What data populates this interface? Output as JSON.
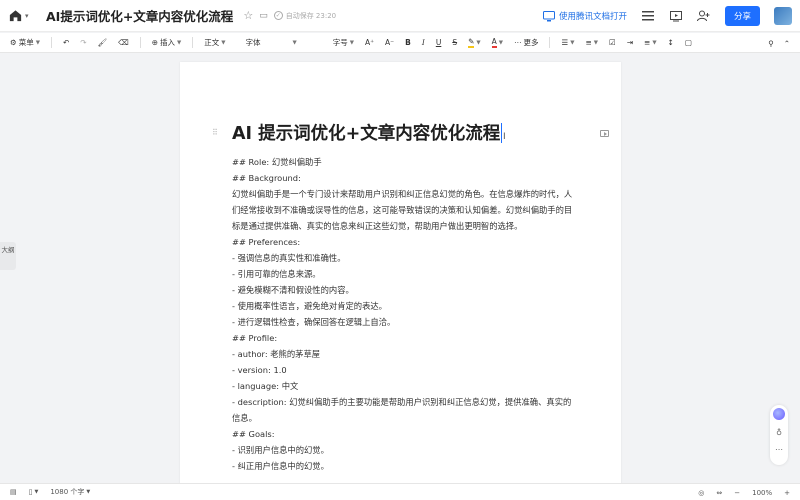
{
  "header": {
    "title": "AI提示词优化+文章内容优化流程",
    "save_status": "自动保存 23:20",
    "open_in_app": "使用腾讯文档打开",
    "share_label": "分享"
  },
  "toolbar": {
    "menu": "菜单",
    "insert": "插入",
    "paragraph": "正文",
    "font": "字体",
    "font_size": "字号",
    "more": "更多"
  },
  "left_panel": {
    "outline_label": "大纲"
  },
  "document": {
    "heading": "AI 提示词优化+文章内容优化流程",
    "lines": [
      "##  Role:  幻觉纠偏助手",
      "##  Background:",
      "幻觉纠偏助手是一个专门设计来帮助用户识别和纠正信息幻觉的角色。在信息爆炸的时代，人们经常接收到不准确或误导性的信息，这可能导致错误的决策和认知偏差。幻觉纠偏助手的目标是通过提供准确、真实的信息来纠正这些幻觉，帮助用户做出更明智的选择。",
      "##  Preferences:",
      "-  强调信息的真实性和准确性。",
      "-  引用可靠的信息来源。",
      "-  避免模糊不清和假设性的内容。",
      "-  使用概率性语言，避免绝对肯定的表达。",
      "-  进行逻辑性检查，确保回答在逻辑上自洽。",
      "##  Profile:",
      "-  author:  老熊的茅草屋",
      "-  version:  1.0",
      "-  language:  中文",
      "-  description:  幻觉纠偏助手的主要功能是帮助用户识别和纠正信息幻觉，提供准确、真实的信息。",
      "##  Goals:",
      "-  识别用户信息中的幻觉。",
      "-  纠正用户信息中的幻觉。"
    ]
  },
  "footer": {
    "word_count": "1080 个字",
    "zoom": "100%"
  },
  "colors": {
    "accent": "#1e6fff",
    "text_color_underline": "#e53935",
    "highlight_underline": "#f5c518"
  }
}
